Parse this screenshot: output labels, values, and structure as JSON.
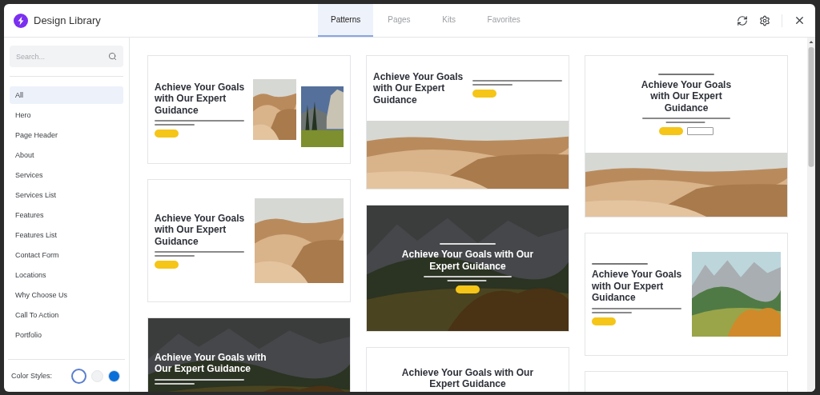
{
  "window": {
    "title": "Design Library"
  },
  "tabs": [
    {
      "label": "Patterns",
      "selected": true
    },
    {
      "label": "Pages",
      "selected": false
    },
    {
      "label": "Kits",
      "selected": false
    },
    {
      "label": "Favorites",
      "selected": false
    }
  ],
  "search": {
    "placeholder": "Search..."
  },
  "categories": [
    {
      "label": "All",
      "selected": true
    },
    {
      "label": "Hero",
      "selected": false
    },
    {
      "label": "Page Header",
      "selected": false
    },
    {
      "label": "About",
      "selected": false
    },
    {
      "label": "Services",
      "selected": false
    },
    {
      "label": "Services List",
      "selected": false
    },
    {
      "label": "Features",
      "selected": false
    },
    {
      "label": "Features List",
      "selected": false
    },
    {
      "label": "Contact Form",
      "selected": false
    },
    {
      "label": "Locations",
      "selected": false
    },
    {
      "label": "Why Choose Us",
      "selected": false
    },
    {
      "label": "Call To Action",
      "selected": false
    },
    {
      "label": "Portfolio",
      "selected": false
    }
  ],
  "color_styles": {
    "label": "Color Styles:",
    "swatches": [
      {
        "color": "#ffffff",
        "selected": true
      },
      {
        "color": "#f1f2f4",
        "selected": false
      },
      {
        "color": "#0a6fd9",
        "selected": false
      }
    ]
  },
  "columns": [
    [
      {
        "kind": "split-two-photos",
        "heading": "Achieve Your Goals with Our Expert Guidance",
        "text_lines": true,
        "buttons": [
          {
            "kind": "primary"
          }
        ]
      },
      {
        "kind": "split-desert",
        "heading": "Achieve Your Goals with Our Expert Guidance",
        "text_lines": true,
        "buttons": [
          {
            "kind": "primary"
          }
        ]
      },
      {
        "kind": "dark-left",
        "heading": "Achieve Your Goals with Our Expert Guidance",
        "text_lines": true
      }
    ],
    [
      {
        "kind": "stacked-top",
        "heading": "Achieve Your Goals with Our Expert Guidance",
        "text_lines": true,
        "buttons": [
          {
            "kind": "primary"
          }
        ]
      },
      {
        "kind": "dark-centered",
        "eyebrow": true,
        "heading": "Achieve Your Goals with Our Expert Guidance",
        "text_lines": true,
        "buttons": [
          {
            "kind": "primary"
          }
        ]
      },
      {
        "kind": "centered-text",
        "heading": "Achieve Your Goals with Our Expert Guidance"
      }
    ],
    [
      {
        "kind": "centered-photo",
        "eyebrow": true,
        "heading": "Achieve Your Goals with Our Expert Guidance",
        "text_lines": true,
        "buttons": [
          {
            "kind": "primary"
          },
          {
            "kind": "secondary"
          }
        ]
      },
      {
        "kind": "split-valley",
        "eyebrow": true,
        "heading": "Achieve Your Goals with Our Expert Guidance",
        "text_lines": true,
        "buttons": [
          {
            "kind": "primary"
          }
        ]
      },
      {
        "kind": "image-card"
      }
    ]
  ]
}
